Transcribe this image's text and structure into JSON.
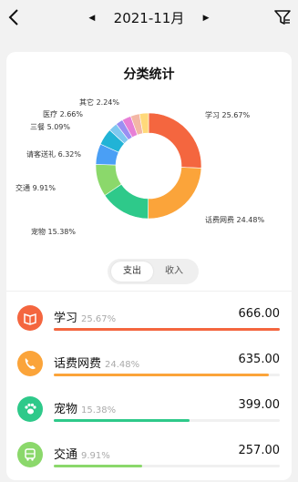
{
  "header": {
    "month": "2021-11月",
    "prev_icon": "triangle-left-icon",
    "next_icon": "triangle-right-icon"
  },
  "card": {
    "title": "分类统计"
  },
  "chart_data": {
    "type": "pie",
    "categories": [
      "学习",
      "话费网费",
      "宠物",
      "交通",
      "请客送礼",
      "三餐",
      "医疗",
      "其它"
    ],
    "values": [
      25.67,
      24.48,
      15.38,
      9.91,
      6.32,
      5.09,
      2.66,
      2.24
    ],
    "labels": [
      "学习 25.67%",
      "话费网费 24.48%",
      "宠物 15.38%",
      "交通 9.91%",
      "请客送礼 6.32%",
      "三餐 5.09%",
      "医疗 2.66%",
      "其它 2.24%"
    ],
    "colors": [
      "#f4663f",
      "#fba43a",
      "#2ec98a",
      "#8bd86b",
      "#4a9ff5",
      "#21b3d6",
      "#7fc8f0",
      "#9a8ff2"
    ],
    "small_slice_colors": [
      "#e77fd6",
      "#f3b7a5",
      "#ffd97a"
    ]
  },
  "toggle": {
    "expense": "支出",
    "income": "收入"
  },
  "rows": [
    {
      "name": "学习",
      "pct": "25.67%",
      "amount": "666.00",
      "fraction": 1.0,
      "color": "#f4663f",
      "icon": "book-icon"
    },
    {
      "name": "话费网费",
      "pct": "24.48%",
      "amount": "635.00",
      "fraction": 0.95,
      "color": "#fba43a",
      "icon": "phone-icon"
    },
    {
      "name": "宠物",
      "pct": "15.38%",
      "amount": "399.00",
      "fraction": 0.6,
      "color": "#2ec98a",
      "icon": "paw-icon"
    },
    {
      "name": "交通",
      "pct": "9.91%",
      "amount": "257.00",
      "fraction": 0.39,
      "color": "#8bd86b",
      "icon": "bus-icon"
    }
  ]
}
